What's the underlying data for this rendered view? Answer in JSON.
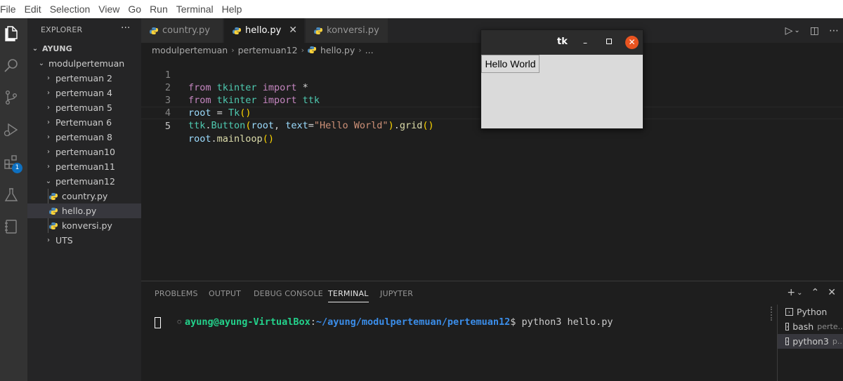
{
  "menu": [
    "File",
    "Edit",
    "Selection",
    "View",
    "Go",
    "Run",
    "Terminal",
    "Help"
  ],
  "activity": {
    "icons": [
      "files-icon",
      "search-icon",
      "source-control-icon",
      "run-debug-icon",
      "extensions-icon",
      "testing-icon",
      "notebook-icon"
    ],
    "extensions_badge": "1"
  },
  "sidebar": {
    "title": "EXPLORER",
    "more": "···",
    "root": "AYUNG",
    "folder": "modulpertemuan",
    "items": [
      {
        "label": "pertemuan 2",
        "type": "folder"
      },
      {
        "label": "pertemuan 4",
        "type": "folder"
      },
      {
        "label": "pertemuan 5",
        "type": "folder"
      },
      {
        "label": "Pertemuan 6",
        "type": "folder"
      },
      {
        "label": "pertemuan 8",
        "type": "folder"
      },
      {
        "label": "pertemuan10",
        "type": "folder"
      },
      {
        "label": "pertemuan11",
        "type": "folder"
      },
      {
        "label": "pertemuan12",
        "type": "folder-open"
      },
      {
        "label": "country.py",
        "type": "file"
      },
      {
        "label": "hello.py",
        "type": "file-selected"
      },
      {
        "label": "konversi.py",
        "type": "file"
      },
      {
        "label": "UTS",
        "type": "folder"
      }
    ]
  },
  "tabs": [
    {
      "label": "country.py",
      "active": false
    },
    {
      "label": "hello.py",
      "active": true
    },
    {
      "label": "konversi.py",
      "active": false
    }
  ],
  "breadcrumb": [
    "modulpertemuan",
    "pertemuan12",
    "hello.py",
    "..."
  ],
  "editor": {
    "lines": [
      "1",
      "2",
      "3",
      "4",
      "5"
    ],
    "code": [
      "from tkinter import *",
      "from tkinter import ttk",
      "root = Tk()",
      "ttk.Button(root, text=\"Hello World\").grid()",
      "root.mainloop()"
    ]
  },
  "panel": {
    "tabs": [
      "PROBLEMS",
      "OUTPUT",
      "DEBUG CONSOLE",
      "TERMINAL",
      "JUPYTER"
    ],
    "active_tab": "TERMINAL",
    "terminal": {
      "user": "ayung@ayung-VirtualBox",
      "path": "~/ayung/modulpertemuan/pertemuan12",
      "command": "python3 hello.py"
    },
    "terminals": [
      {
        "name": "Python",
        "sub": ""
      },
      {
        "name": "bash",
        "sub": "perte..."
      },
      {
        "name": "python3",
        "sub": "p..."
      }
    ]
  },
  "tk_window": {
    "title": "tk",
    "button_label": "Hello World"
  },
  "colors": {
    "accent": "#0e70c0",
    "close_button": "#e95420",
    "terminal_user": "#23d18b",
    "terminal_path": "#3b8eea"
  }
}
